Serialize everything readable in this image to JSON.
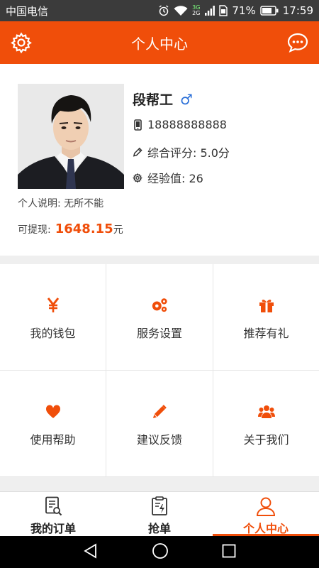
{
  "status_bar": {
    "carrier": "中国电信",
    "network_top": "3G",
    "network_bottom": "2G",
    "battery": "71%",
    "time": "17:59"
  },
  "header": {
    "title": "个人中心",
    "left_icon": "gear-icon",
    "right_icon": "chat-bubble-icon"
  },
  "profile": {
    "name": "段帮工",
    "gender_symbol": "♂",
    "phone": "18888888888",
    "rating_label": "综合评分: 5.0分",
    "experience_label": "经验值: 26",
    "description": "个人说明: 无所不能",
    "withdraw_label": "可提现:",
    "withdraw_amount": "1648.15",
    "withdraw_unit": "元"
  },
  "menu": [
    {
      "label": "我的钱包",
      "icon": "yen-icon"
    },
    {
      "label": "服务设置",
      "icon": "gears-icon"
    },
    {
      "label": "推荐有礼",
      "icon": "gift-icon"
    },
    {
      "label": "使用帮助",
      "icon": "heart-icon"
    },
    {
      "label": "建议反馈",
      "icon": "pencil-icon"
    },
    {
      "label": "关于我们",
      "icon": "users-icon"
    }
  ],
  "tabs": [
    {
      "label": "我的订单",
      "icon": "order-list-icon"
    },
    {
      "label": "抢单",
      "icon": "clipboard-lightning-icon"
    },
    {
      "label": "个人中心",
      "icon": "user-icon",
      "active": true
    }
  ],
  "colors": {
    "accent": "#f04e0a",
    "status_bar": "#3b3b3b",
    "gender": "#2a6fd8"
  }
}
